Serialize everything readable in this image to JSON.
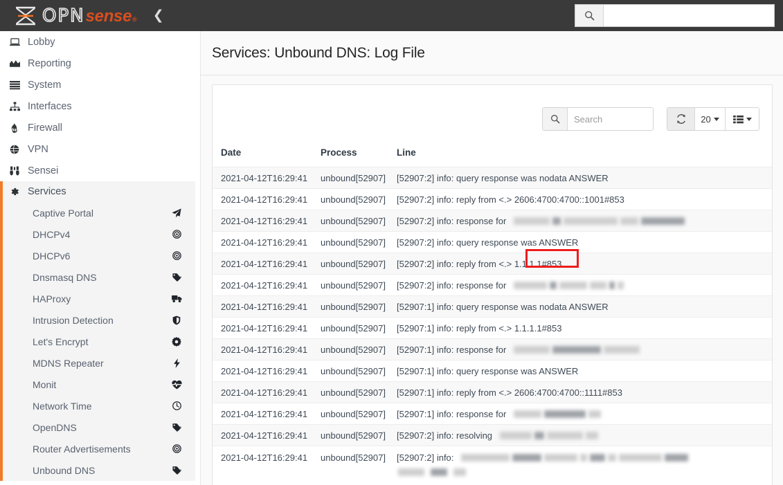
{
  "header": {
    "brand_opn": "OPN",
    "brand_sense": "sense",
    "brand_reg": "®",
    "collapse_icon": "chevron-left-icon",
    "search_icon": "search-icon",
    "search_value": "",
    "search_placeholder": ""
  },
  "colors": {
    "topbar": "#3a3a3a",
    "accent_orange": "#f07c28",
    "brand_orange": "#d94e1f",
    "highlight_red": "#ee1c1c",
    "row_alt": "#f8f8f8"
  },
  "sidebar": {
    "top_items": [
      {
        "label": "Lobby",
        "icon": "laptop-icon"
      },
      {
        "label": "Reporting",
        "icon": "chart-area-icon"
      },
      {
        "label": "System",
        "icon": "server-icon"
      },
      {
        "label": "Interfaces",
        "icon": "sitemap-icon"
      },
      {
        "label": "Firewall",
        "icon": "fire-icon"
      },
      {
        "label": "VPN",
        "icon": "globe-icon"
      },
      {
        "label": "Sensei",
        "icon": "binoculars-icon"
      }
    ],
    "services": {
      "label": "Services",
      "icon": "gear-icon",
      "items": [
        {
          "label": "Captive Portal",
          "icon": "paper-plane-icon"
        },
        {
          "label": "DHCPv4",
          "icon": "bullseye-icon"
        },
        {
          "label": "DHCPv6",
          "icon": "bullseye-icon"
        },
        {
          "label": "Dnsmasq DNS",
          "icon": "tags-icon"
        },
        {
          "label": "HAProxy",
          "icon": "truck-icon"
        },
        {
          "label": "Intrusion Detection",
          "icon": "shield-icon"
        },
        {
          "label": "Let's Encrypt",
          "icon": "certificate-icon"
        },
        {
          "label": "MDNS Repeater",
          "icon": "bolt-icon"
        },
        {
          "label": "Monit",
          "icon": "heartbeat-icon"
        },
        {
          "label": "Network Time",
          "icon": "clock-icon"
        },
        {
          "label": "OpenDNS",
          "icon": "tags-icon"
        },
        {
          "label": "Router Advertisements",
          "icon": "bullseye-icon"
        },
        {
          "label": "Unbound DNS",
          "icon": "tags-icon"
        }
      ]
    }
  },
  "main": {
    "page_title": "Services: Unbound DNS: Log File",
    "toolbar": {
      "search_icon": "search-icon",
      "search_value": "",
      "search_placeholder": "Search",
      "refresh_icon": "refresh-icon",
      "refresh_label": "",
      "page_size": "20",
      "columns_icon": "columns-list-icon",
      "columns_label": ""
    },
    "table": {
      "columns": [
        "Date",
        "Process",
        "Line"
      ],
      "rows": [
        {
          "date": "2021-04-12T16:29:41",
          "process": "unbound[52907]",
          "line": "[52907:2] info: query response was nodata ANSWER",
          "redacted": []
        },
        {
          "date": "2021-04-12T16:29:41",
          "process": "unbound[52907]",
          "line": "[52907:2] info: reply from <.> 2606:4700:4700::1001#853",
          "redacted": []
        },
        {
          "date": "2021-04-12T16:29:41",
          "process": "unbound[52907]",
          "line": "[52907:2] info: response for",
          "redacted": [
            52,
            12,
            78,
            26,
            63
          ]
        },
        {
          "date": "2021-04-12T16:29:41",
          "process": "unbound[52907]",
          "line": "[52907:2] info: query response was ANSWER",
          "redacted": []
        },
        {
          "date": "2021-04-12T16:29:41",
          "process": "unbound[52907]",
          "line": "[52907:2] info: reply from <.> 1.1.1.1#853",
          "redacted": [],
          "highlight": "1.1.1.1#853"
        },
        {
          "date": "2021-04-12T16:29:41",
          "process": "unbound[52907]",
          "line": "[52907:2] info: response for",
          "redacted": [
            48,
            10,
            40,
            24,
            8,
            9
          ]
        },
        {
          "date": "2021-04-12T16:29:41",
          "process": "unbound[52907]",
          "line": "[52907:1] info: query response was nodata ANSWER",
          "redacted": []
        },
        {
          "date": "2021-04-12T16:29:41",
          "process": "unbound[52907]",
          "line": "[52907:1] info: reply from <.> 1.1.1.1#853",
          "redacted": []
        },
        {
          "date": "2021-04-12T16:29:41",
          "process": "unbound[52907]",
          "line": "[52907:1] info: response for",
          "redacted": [
            52,
            70,
            52
          ]
        },
        {
          "date": "2021-04-12T16:29:41",
          "process": "unbound[52907]",
          "line": "[52907:1] info: query response was ANSWER",
          "redacted": []
        },
        {
          "date": "2021-04-12T16:29:41",
          "process": "unbound[52907]",
          "line": "[52907:1] info: reply from <.> 2606:4700:4700::1111#853",
          "redacted": []
        },
        {
          "date": "2021-04-12T16:29:41",
          "process": "unbound[52907]",
          "line": "[52907:1] info: response for",
          "redacted": [
            40,
            60,
            18
          ]
        },
        {
          "date": "2021-04-12T16:29:41",
          "process": "unbound[52907]",
          "line": "[52907:2] info: resolving",
          "redacted": [
            46,
            14,
            52,
            18
          ]
        },
        {
          "date": "2021-04-12T16:29:41",
          "process": "unbound[52907]",
          "line": "[52907:2] info:",
          "redacted": [
            70,
            42,
            48,
            10,
            22,
            12,
            62,
            34
          ],
          "redacted2": [
            38,
            24,
            18
          ]
        }
      ]
    }
  },
  "annotation": {
    "highlight_text": "1.1.1.1#853",
    "shape": "red-rectangle-outline"
  }
}
